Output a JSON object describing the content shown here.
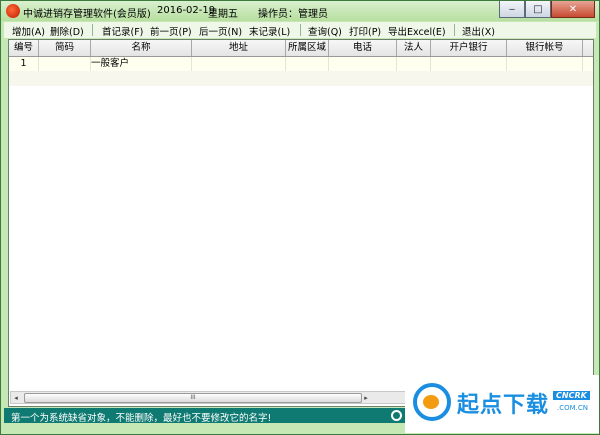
{
  "window": {
    "app_title": "中诚进销存管理软件(会员版)",
    "date": "2016-02-19",
    "weekday": "星期五",
    "operator": "操作员：管理员"
  },
  "title_buttons": {
    "minimize": "‒",
    "maximize": "□",
    "close": "✕"
  },
  "toolbar": {
    "add": "增加(A)",
    "delete": "删除(D)",
    "first": "首记录(F)",
    "prev": "前一页(P)",
    "next": "后一页(N)",
    "last": "末记录(L)",
    "query": "查询(Q)",
    "print": "打印(P)",
    "export": "导出Excel(E)",
    "exit": "退出(X)"
  },
  "grid": {
    "columns": [
      "编号",
      "简码",
      "名称",
      "地址",
      "所属区域",
      "电话",
      "法人",
      "开户银行",
      "银行帐号"
    ],
    "rows": [
      [
        "1",
        "",
        "一般客户",
        "",
        "",
        "",
        "",
        "",
        ""
      ]
    ]
  },
  "scrollbar": {
    "left_arrow": "◂",
    "right_arrow": "▸",
    "grip": "III"
  },
  "status": {
    "message": "第一个为系统缺省对象，不能删除，最好也不要修改它的名字!"
  },
  "watermark": {
    "text": "起点下载",
    "brand": "CNCRK",
    "domain": ".COM.CN"
  },
  "colors": {
    "frame": "#c5e8b5",
    "status_bar": "#0f7a72",
    "row_highlight": "#fffff0"
  }
}
